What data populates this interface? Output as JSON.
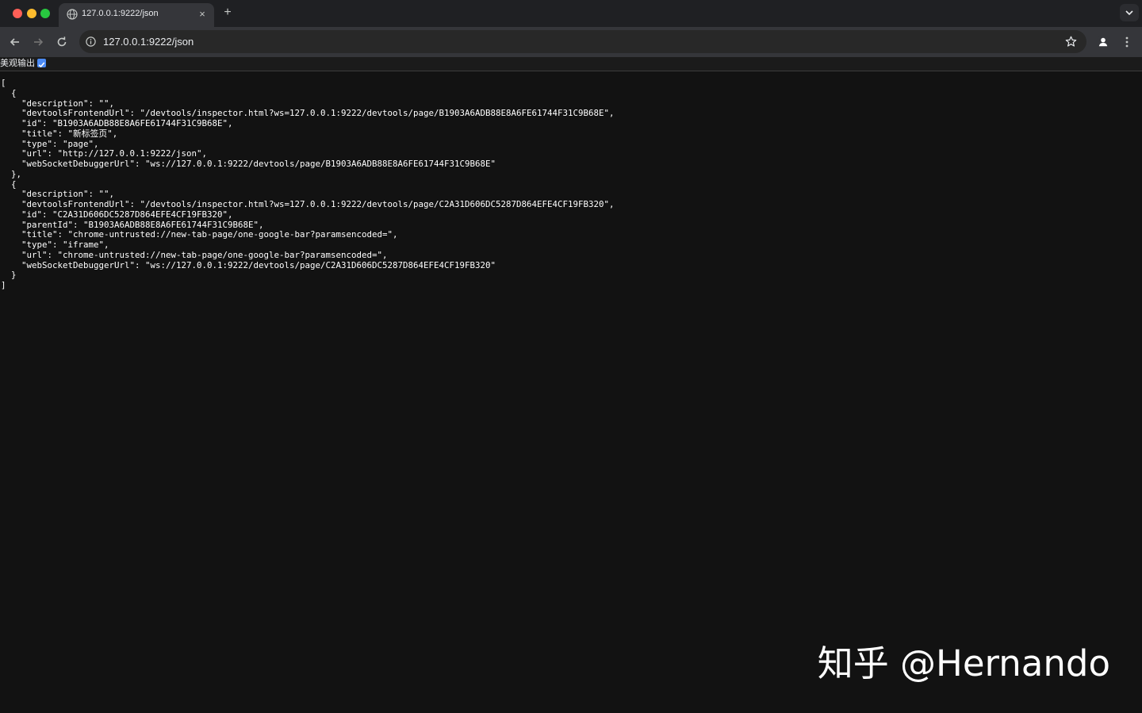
{
  "browser": {
    "tab": {
      "title": "127.0.0.1:9222/json",
      "close_glyph": "×"
    },
    "new_tab_glyph": "+",
    "address_bar": {
      "url": "127.0.0.1:9222/json"
    },
    "icons": {
      "tab_favicon": "globe-icon",
      "back": "arrow-left-icon",
      "forward": "arrow-right-icon",
      "reload": "reload-icon",
      "site_info": "info-icon",
      "bookmark": "star-icon",
      "profile": "person-icon",
      "menu": "vertical-dots-icon",
      "tab_search": "chevron-down-icon"
    }
  },
  "page": {
    "pretty_print_label": "美观输出",
    "pretty_print_checked": true,
    "json_text": "[\n  {\n    \"description\": \"\",\n    \"devtoolsFrontendUrl\": \"/devtools/inspector.html?ws=127.0.0.1:9222/devtools/page/B1903A6ADB88E8A6FE61744F31C9B68E\",\n    \"id\": \"B1903A6ADB88E8A6FE61744F31C9B68E\",\n    \"title\": \"新标签页\",\n    \"type\": \"page\",\n    \"url\": \"http://127.0.0.1:9222/json\",\n    \"webSocketDebuggerUrl\": \"ws://127.0.0.1:9222/devtools/page/B1903A6ADB88E8A6FE61744F31C9B68E\"\n  },\n  {\n    \"description\": \"\",\n    \"devtoolsFrontendUrl\": \"/devtools/inspector.html?ws=127.0.0.1:9222/devtools/page/C2A31D606DC5287D864EFE4CF19FB320\",\n    \"id\": \"C2A31D606DC5287D864EFE4CF19FB320\",\n    \"parentId\": \"B1903A6ADB88E8A6FE61744F31C9B68E\",\n    \"title\": \"chrome-untrusted://new-tab-page/one-google-bar?paramsencoded=\",\n    \"type\": \"iframe\",\n    \"url\": \"chrome-untrusted://new-tab-page/one-google-bar?paramsencoded=\",\n    \"webSocketDebuggerUrl\": \"ws://127.0.0.1:9222/devtools/page/C2A31D606DC5287D864EFE4CF19FB320\"\n  }\n]"
  },
  "watermark": "知乎 @Hernando",
  "colors": {
    "tab_strip": "#1f2023",
    "toolbar": "#35363a",
    "omnibox": "#282828",
    "page_background": "#121212",
    "checkbox": "#4c8bf5",
    "traffic_red": "#ff5f57",
    "traffic_yellow": "#febc2e",
    "traffic_green": "#28c840"
  }
}
